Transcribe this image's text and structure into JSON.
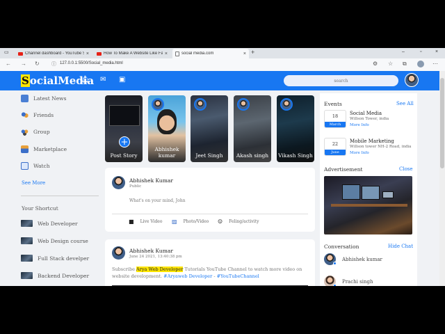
{
  "browser": {
    "tabs": [
      {
        "label": "Channel dashboard - YouTube S",
        "favicon": "youtube-icon"
      },
      {
        "label": "How To Make A Website Like Fa",
        "favicon": "youtube-icon"
      },
      {
        "label": "social media.com",
        "favicon": "page-icon"
      }
    ],
    "url": "127.0.0.1:5500/Social_media.html"
  },
  "navbar": {
    "logo_first": "S",
    "logo_rest": "ocialMedia",
    "search_placeholder": "search",
    "icons": [
      "bell-icon",
      "mail-icon",
      "video-icon"
    ]
  },
  "sidebar": {
    "items": [
      {
        "label": "Latest News",
        "icon": "news-icon"
      },
      {
        "label": "Friends",
        "icon": "friends-icon"
      },
      {
        "label": "Group",
        "icon": "group-icon"
      },
      {
        "label": "Marketplace",
        "icon": "marketplace-icon"
      },
      {
        "label": "Watch",
        "icon": "watch-icon"
      }
    ],
    "see_more": "See More",
    "shortcut_title": "Your Shortcut",
    "shortcuts": [
      "Web Developer",
      "Web Design course",
      "Full Stack develper",
      "Backend Developer"
    ]
  },
  "stories": [
    {
      "name": "Post Story"
    },
    {
      "name": "Abhishek kumar"
    },
    {
      "name": "Jeet Singh"
    },
    {
      "name": "Akash singh"
    },
    {
      "name": "Vikash Singh"
    }
  ],
  "create_post": {
    "name": "Abhishek Kumar",
    "privacy": "Public",
    "prompt": "What's on your mind, John",
    "actions": [
      {
        "label": "Live Video",
        "icon": "camera-icon"
      },
      {
        "label": "Photo/Video",
        "icon": "image-icon"
      },
      {
        "label": "Feling/activity",
        "icon": "smile-icon"
      }
    ]
  },
  "post": {
    "name": "Abhishek Kumar",
    "date": "June 24 2021, 13:40:38 pm",
    "text_1": "Subscribe ",
    "highlight": "Arya Web Developer",
    "text_2": " Tutorials YouTube Channel to watch more video on website development. ",
    "link_1": "#Aryaweb Developer",
    "text_3": " - ",
    "link_2": "#YouTubeChannel"
  },
  "events": {
    "title": "Events",
    "see_all": "See All",
    "items": [
      {
        "day": "18",
        "month": "March",
        "title": "Social Media",
        "address": "Willson Tower, india",
        "more": "More Info"
      },
      {
        "day": "22",
        "month": "June",
        "title": "Mobile Marketing",
        "address": "Willson tower NH-2 Road, india",
        "more": "More Info"
      }
    ]
  },
  "advertisement": {
    "title": "Advertisement",
    "close": "Close"
  },
  "conversation": {
    "title": "Conversation",
    "hide": "Hide Chat",
    "items": [
      {
        "name": "Abhishek kumar"
      },
      {
        "name": "Prachi singh"
      }
    ]
  },
  "colors": {
    "brand": "#1877f2",
    "highlight": "#ffe600",
    "background": "#f0f2f5"
  }
}
